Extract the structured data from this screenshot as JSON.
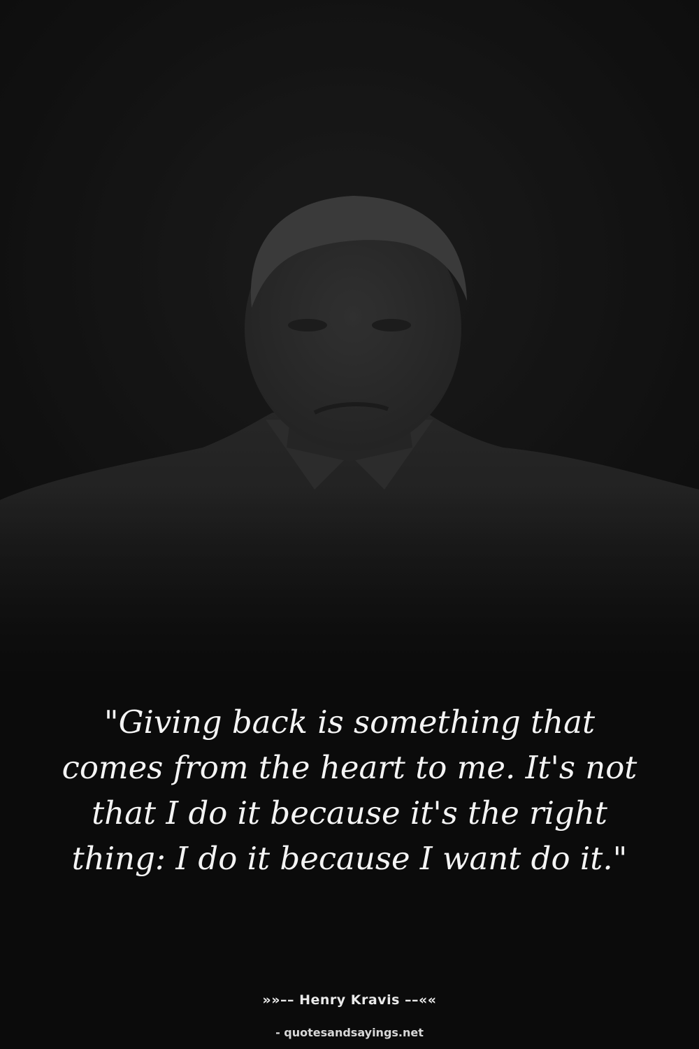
{
  "quote": {
    "text": "\"Giving back is something that comes from the heart to me. It's not that I do it because it's the right thing: I do it because I want do it.\""
  },
  "attribution": {
    "author_line": "»»–– Henry Kravis ––««",
    "source": "- quotesandsayings.net"
  },
  "colors": {
    "background": "#0b0b0b",
    "text": "#f4f4f4"
  }
}
